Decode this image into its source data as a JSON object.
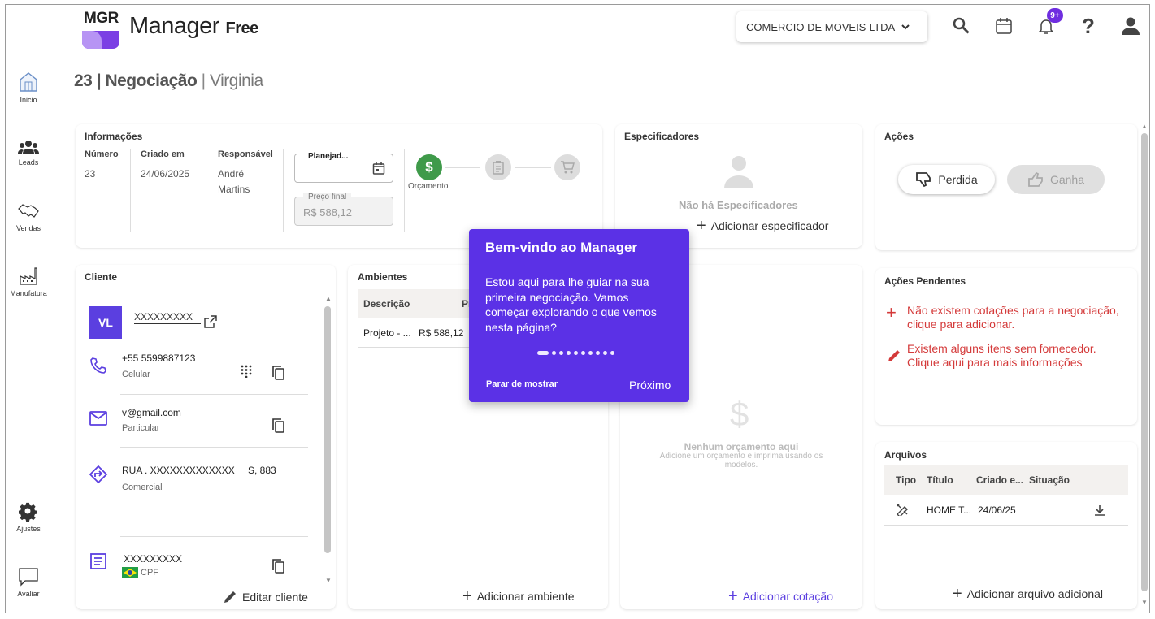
{
  "header": {
    "logo_text": "MGR",
    "brand": "Manager",
    "brand_suffix": "Free",
    "company": "COMERCIO DE MOVEIS LTDA",
    "notif_badge": "9+"
  },
  "sidebar": {
    "items": [
      {
        "label": "Inicio",
        "icon": "home-icon"
      },
      {
        "label": "Leads",
        "icon": "people-icon"
      },
      {
        "label": "Vendas",
        "icon": "handshake-icon"
      },
      {
        "label": "Manufatura",
        "icon": "factory-icon"
      },
      {
        "label": "Ajustes",
        "icon": "gear-icon"
      },
      {
        "label": "Avaliar",
        "icon": "feedback-icon"
      }
    ]
  },
  "page": {
    "number": "23",
    "sep": "|",
    "type": "Negociação",
    "client": "Virginia"
  },
  "info": {
    "title": "Informações",
    "col_numero": "Número",
    "col_criado": "Criado em",
    "col_resp": "Responsável",
    "numero": "23",
    "criado": "24/06/2025",
    "resp_line1": "André",
    "resp_line2": "Martins",
    "planejado_label": "Planejad...",
    "preco_label": "Preço final",
    "preco_value": "R$ 588,12",
    "step_label": "Orçamento"
  },
  "especificadores": {
    "title": "Especificadores",
    "empty": "Não há Especificadores",
    "add": "Adicionar especificador"
  },
  "acoes": {
    "title": "Ações",
    "perdida": "Perdida",
    "ganha": "Ganha"
  },
  "cliente": {
    "title": "Cliente",
    "avatar": "VL",
    "name": "XXXXXXXXX",
    "phone": "+55 5599887123",
    "phone_type": "Celular",
    "email": "v@gmail.com",
    "email_type": "Particular",
    "address": "RUA . XXXXXXXXXXXXX",
    "address_num": "S, 883",
    "address_type": "Comercial",
    "doc": "XXXXXXXXX",
    "doc_type": "CPF",
    "edit": "Editar cliente"
  },
  "ambientes": {
    "title": "Ambientes",
    "col_desc": "Descrição",
    "col_p": "Pr",
    "row_desc": "Projeto - ...",
    "row_val": "R$ 588,12",
    "add": "Adicionar ambiente"
  },
  "orcamento": {
    "empty_title": "Nenhum orçamento aqui",
    "empty_sub": "Adicione um orçamento e imprima usando os modelos.",
    "add": "Adicionar cotação"
  },
  "pendentes": {
    "title": "Ações Pendentes",
    "item1": "Não existem cotações para a negociação, clique para adicionar.",
    "item2": "Existem alguns itens sem fornecedor. Clique aqui para mais informações"
  },
  "arquivos": {
    "title": "Arquivos",
    "col_tipo": "Tipo",
    "col_titulo": "Título",
    "col_criado": "Criado e...",
    "col_situacao": "Situação",
    "row_titulo": "HOME T...",
    "row_criado": "24/06/25",
    "add": "Adicionar arquivo adicional"
  },
  "tooltip": {
    "title": "Bem-vindo ao Manager",
    "body": "Estou aqui para lhe guiar na sua primeira negociação. Vamos começar explorando o que vemos nesta página?",
    "stop": "Parar de mostrar",
    "next": "Próximo"
  },
  "colors": {
    "accent": "#5b3fe0",
    "tooltip_bg": "#5b31e6",
    "success": "#3f9a4a",
    "danger": "#d43a3a"
  }
}
